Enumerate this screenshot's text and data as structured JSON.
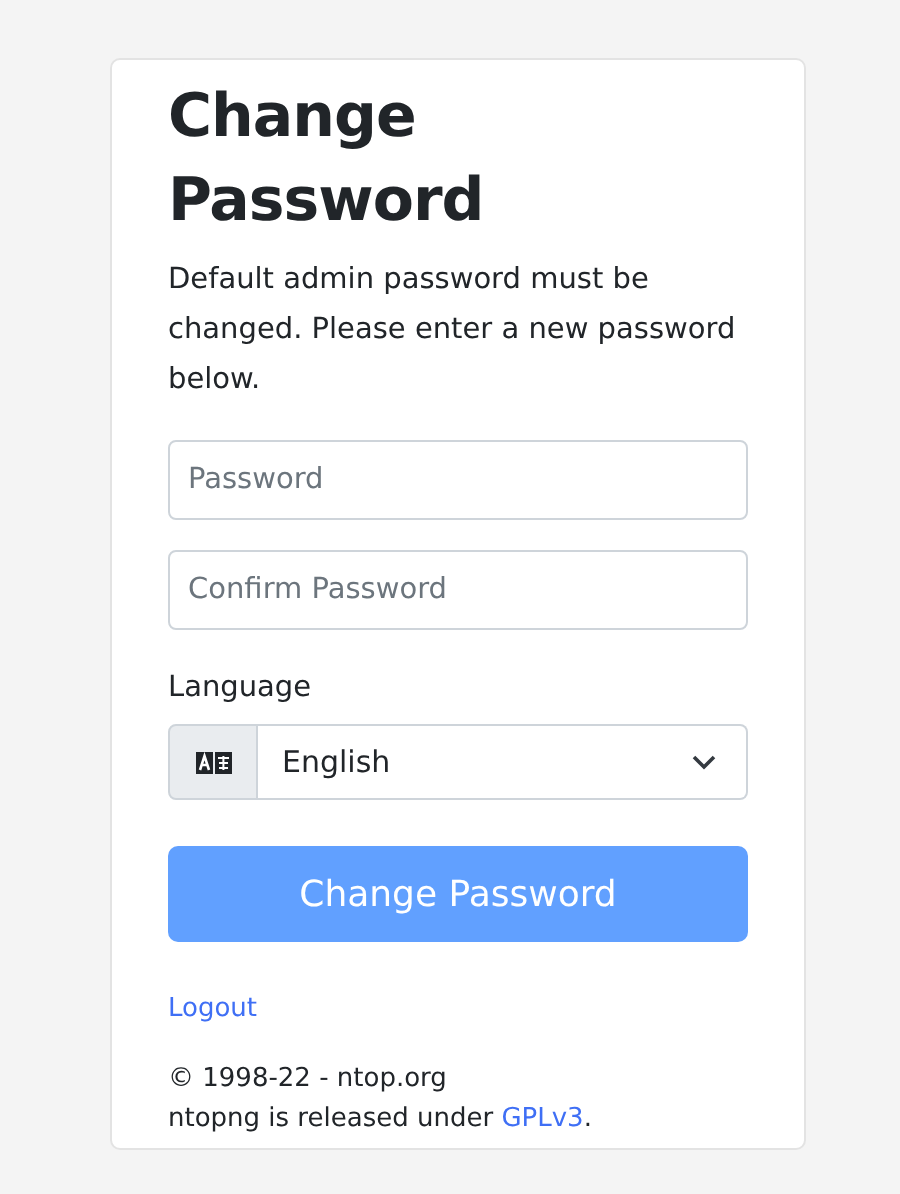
{
  "title": "Change Password",
  "description": "Default admin password must be changed. Please enter a new password below.",
  "fields": [
    {
      "placeholder": "Password"
    },
    {
      "placeholder": "Confirm Password"
    }
  ],
  "language": {
    "label": "Language",
    "value": "English"
  },
  "submit_button": "Change Password",
  "logout_link": "Logout",
  "copyright": "© 1998-22 - ntop.org",
  "license": {
    "prefix": "ntopng is released under ",
    "link": "GPLv3",
    "suffix": "."
  }
}
